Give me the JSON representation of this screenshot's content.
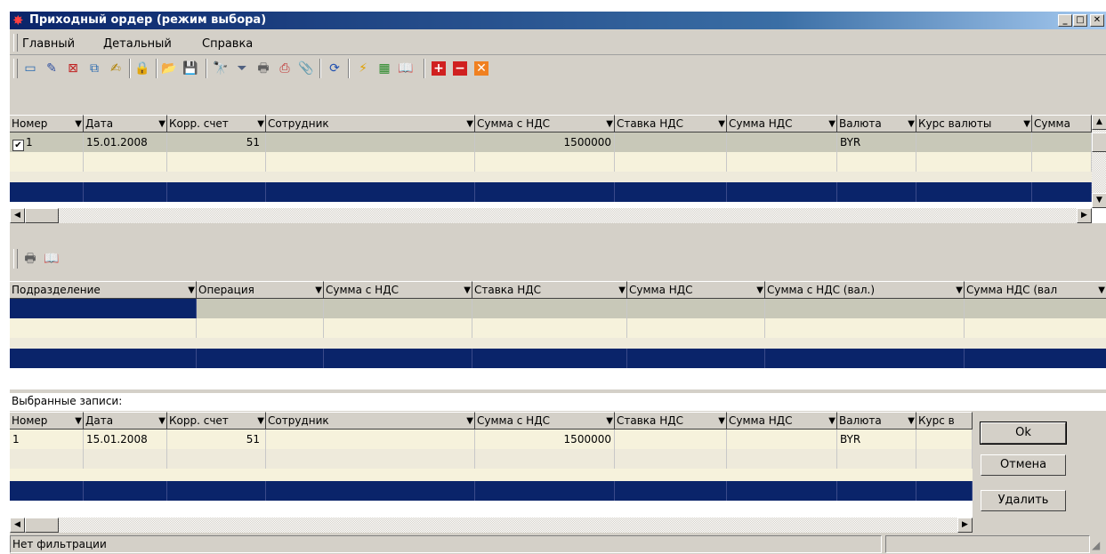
{
  "window": {
    "title": "Приходный ордер (режим выбора)"
  },
  "menu": [
    "Главный",
    "Детальный",
    "Справка"
  ],
  "main_table": {
    "columns": [
      "Номер",
      "Дата",
      "Корр. счет",
      "Сотрудник",
      "Сумма с НДС",
      "Ставка НДС",
      "Сумма НДС",
      "Валюта",
      "Курс валюты",
      "Сумма"
    ],
    "rows": [
      {
        "checked": true,
        "number": "1",
        "date": "15.01.2008",
        "account": "51",
        "employee": "",
        "sum_vat": "1500000",
        "vat_rate": "",
        "vat_sum": "",
        "currency": "BYR",
        "rate": "",
        "sum": ""
      }
    ]
  },
  "detail_table": {
    "columns": [
      "Подразделение",
      "Операция",
      "Сумма с НДС",
      "Ставка НДС",
      "Сумма НДС",
      "Сумма с НДС (вал.)",
      "Сумма НДС (вал"
    ]
  },
  "selected": {
    "label": "Выбранные записи:",
    "columns": [
      "Номер",
      "Дата",
      "Корр. счет",
      "Сотрудник",
      "Сумма с НДС",
      "Ставка НДС",
      "Сумма НДС",
      "Валюта",
      "Курс в"
    ],
    "rows": [
      {
        "number": "1",
        "date": "15.01.2008",
        "account": "51",
        "employee": "",
        "sum_vat": "1500000",
        "vat_rate": "",
        "vat_sum": "",
        "currency": "BYR",
        "rate": ""
      }
    ]
  },
  "buttons": {
    "ok": "Ok",
    "cancel": "Отмена",
    "delete": "Удалить"
  },
  "status": {
    "filter": "Нет фильтрации"
  },
  "colors": {
    "title_start": "#0a246a",
    "selection_navy": "#0a246a",
    "selected_row": "#c8c8b8"
  }
}
